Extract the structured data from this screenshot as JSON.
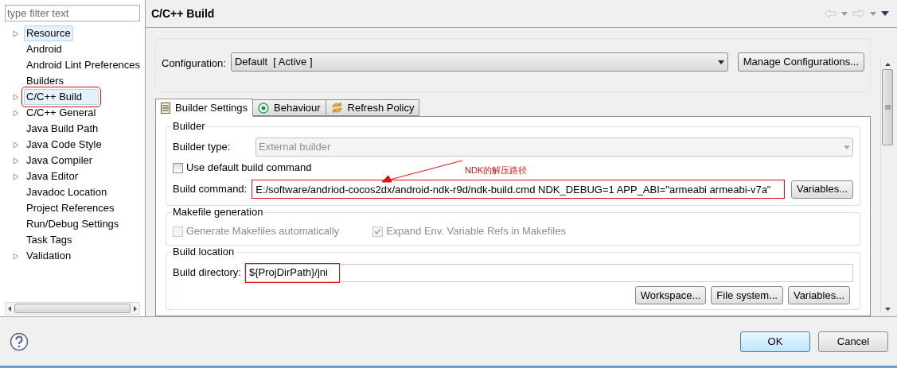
{
  "filter": {
    "placeholder": "type filter text"
  },
  "tree": [
    {
      "label": "Resource",
      "expandable": true,
      "highlighted": true,
      "annotated": false
    },
    {
      "label": "Android",
      "expandable": false,
      "highlighted": false,
      "annotated": false
    },
    {
      "label": "Android Lint Preferences",
      "expandable": false,
      "highlighted": false,
      "annotated": false
    },
    {
      "label": "Builders",
      "expandable": false,
      "highlighted": false,
      "annotated": false
    },
    {
      "label": "C/C++ Build",
      "expandable": true,
      "highlighted": true,
      "annotated": true
    },
    {
      "label": "C/C++ General",
      "expandable": true,
      "highlighted": false,
      "annotated": false
    },
    {
      "label": "Java Build Path",
      "expandable": false,
      "highlighted": false,
      "annotated": false
    },
    {
      "label": "Java Code Style",
      "expandable": true,
      "highlighted": false,
      "annotated": false
    },
    {
      "label": "Java Compiler",
      "expandable": true,
      "highlighted": false,
      "annotated": false
    },
    {
      "label": "Java Editor",
      "expandable": true,
      "highlighted": false,
      "annotated": false
    },
    {
      "label": "Javadoc Location",
      "expandable": false,
      "highlighted": false,
      "annotated": false
    },
    {
      "label": "Project References",
      "expandable": false,
      "highlighted": false,
      "annotated": false
    },
    {
      "label": "Run/Debug Settings",
      "expandable": false,
      "highlighted": false,
      "annotated": false
    },
    {
      "label": "Task Tags",
      "expandable": false,
      "highlighted": false,
      "annotated": false
    },
    {
      "label": "Validation",
      "expandable": true,
      "highlighted": false,
      "annotated": false
    }
  ],
  "page": {
    "title": "C/C++ Build"
  },
  "configuration": {
    "label": "Configuration:",
    "value": "Default  [ Active ]",
    "button": "Manage Configurations..."
  },
  "tabs": [
    {
      "label": "Builder Settings",
      "kind": "list",
      "selected": true
    },
    {
      "label": "Behaviour",
      "kind": "radio",
      "selected": false
    },
    {
      "label": "Refresh Policy",
      "kind": "refresh",
      "selected": false
    }
  ],
  "builder": {
    "title": "Builder",
    "type_label": "Builder type:",
    "type_value": "External builder",
    "type_disabled": true,
    "default_checkbox": {
      "label": "Use default build command",
      "checked": false,
      "disabled": false
    },
    "command_label": "Build command:",
    "command_value": "E:/software/andriod-cocos2dx/android-ndk-r9d/ndk-build.cmd NDK_DEBUG=1 APP_ABI=\"armeabi armeabi-v7a\"",
    "command_annotated": true,
    "variables_button": "Variables...",
    "note": "NDK的解压路径"
  },
  "makefile": {
    "title": "Makefile generation",
    "checkboxes": [
      {
        "label": "Generate Makefiles automatically",
        "checked": false,
        "disabled": true
      },
      {
        "label": "Expand Env. Variable Refs in Makefiles",
        "checked": true,
        "disabled": true
      }
    ]
  },
  "location": {
    "title": "Build location",
    "directory_label": "Build directory:",
    "directory_value": "${ProjDirPath}/jni",
    "directory_annotated": true,
    "buttons": [
      "Workspace...",
      "File system...",
      "Variables..."
    ]
  },
  "footer": {
    "buttons": [
      {
        "label": "OK",
        "default": true
      },
      {
        "label": "Cancel",
        "default": false
      }
    ]
  }
}
